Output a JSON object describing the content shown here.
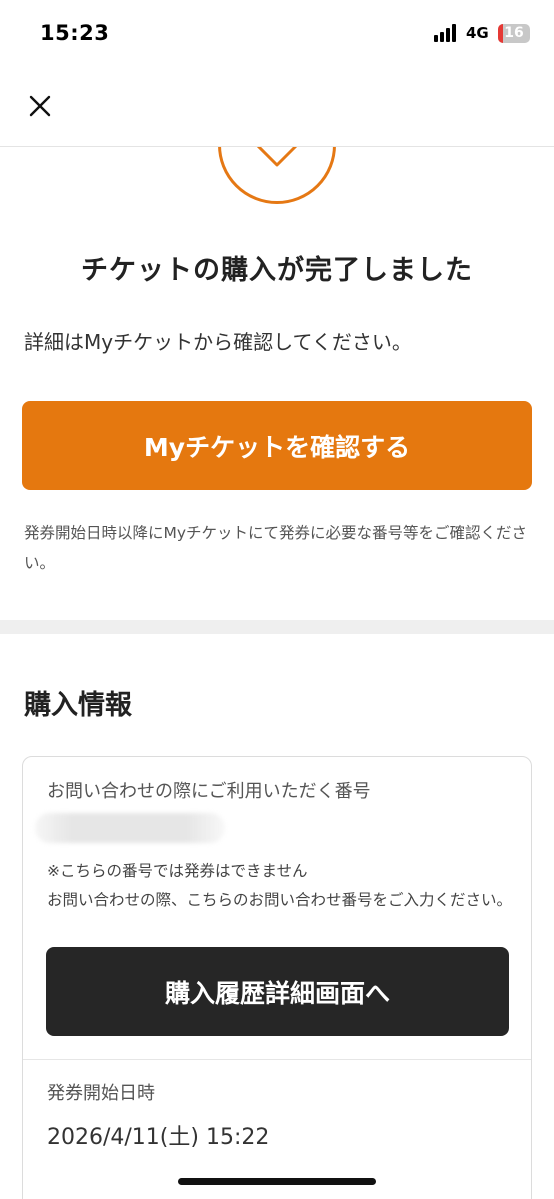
{
  "status_bar": {
    "time": "15:23",
    "network": "4G",
    "battery_level": "16",
    "battery_color": "#e53935"
  },
  "header": {
    "close_icon": "close-icon"
  },
  "success_icon": "check-circle-icon",
  "complete": {
    "title": "チケットの購入が完了しました",
    "description": "詳細はMyチケットから確認してください。",
    "confirm_button_label": "Myチケットを確認する",
    "notice": "発券開始日時以降にMyチケットにて発券に必要な番号等をご確認ください。"
  },
  "purchase_info": {
    "section_title": "購入情報",
    "inquiry_label": "お問い合わせの際にご利用いただく番号",
    "inquiry_note_line1": "※こちらの番号では発券はできません",
    "inquiry_note_line2": "お問い合わせの際、こちらのお問い合わせ番号をご入力ください。",
    "history_button_label": "購入履歴詳細画面へ",
    "issue_start_label": "発券開始日時",
    "issue_start_value": "2026/4/11(土) 15:22"
  },
  "colors": {
    "accent": "#e5780f",
    "dark_button": "#262626"
  }
}
